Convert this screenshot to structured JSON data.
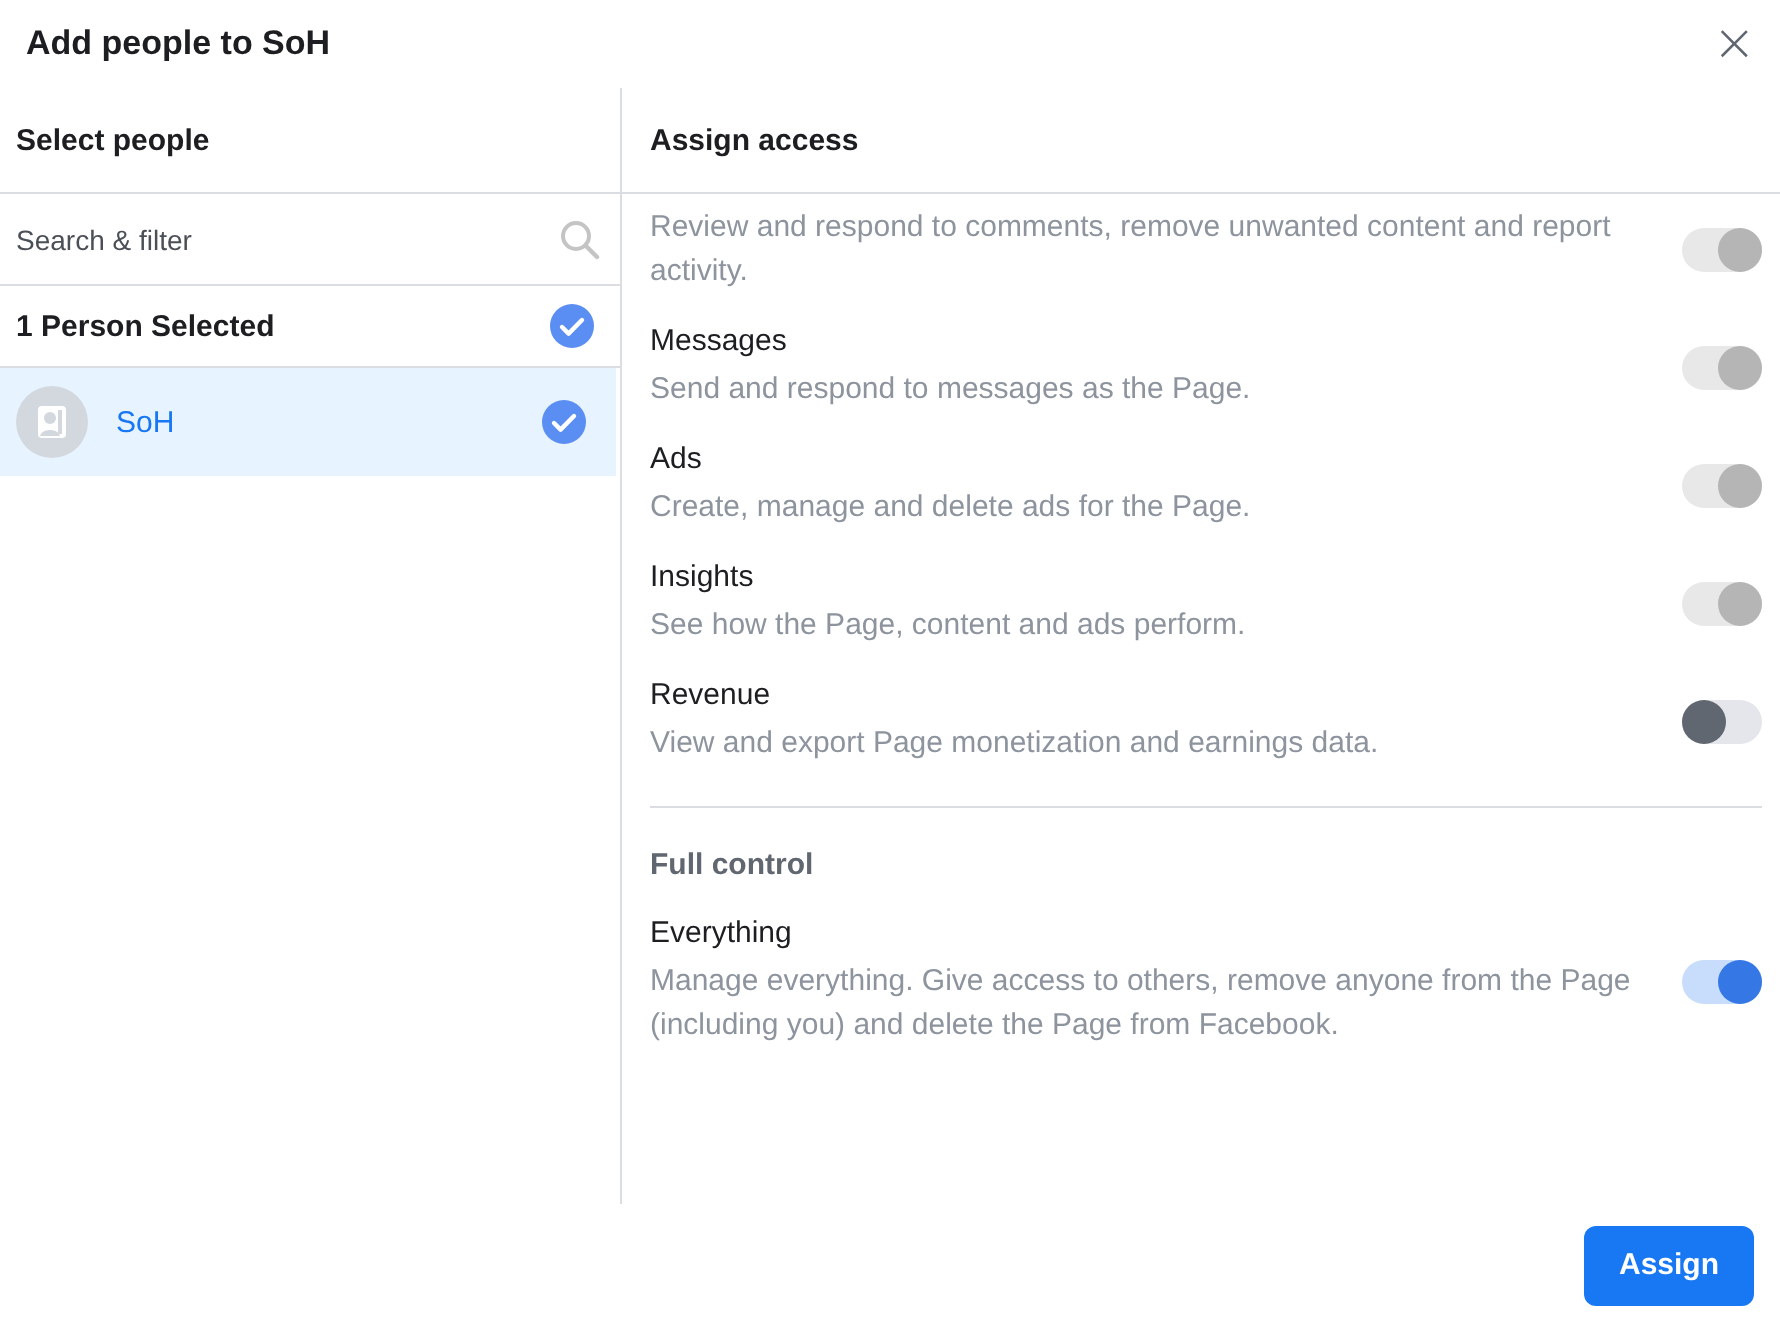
{
  "dialog": {
    "title": "Add people to SoH",
    "close": "×"
  },
  "select_panel": {
    "heading": "Select people",
    "search": {
      "placeholder": "Search & filter"
    },
    "selected_summary": {
      "label": "1 Person Selected",
      "checked": true
    },
    "people": [
      {
        "name": "SoH",
        "selected": true,
        "checked": true
      }
    ]
  },
  "access_panel": {
    "heading": "Assign access",
    "sections": [
      {
        "items": [
          {
            "description": "Review and respond to comments, remove unwanted content and report activity.",
            "on": true,
            "disabled": true
          },
          {
            "title": "Messages",
            "description": "Send and respond to messages as the Page.",
            "on": true,
            "disabled": true
          },
          {
            "title": "Ads",
            "description": "Create, manage and delete ads for the Page.",
            "on": true,
            "disabled": true
          },
          {
            "title": "Insights",
            "description": "See how the Page, content and ads perform.",
            "on": true,
            "disabled": true
          },
          {
            "title": "Revenue",
            "description": "View and export Page monetization and earnings data.",
            "on": false,
            "disabled": false
          }
        ]
      },
      {
        "heading": "Full control",
        "items": [
          {
            "title": "Everything",
            "description": "Manage everything. Give access to others, remove anyone from the Page (including you) and delete the Page from Facebook.",
            "on": true,
            "disabled": false
          }
        ]
      }
    ]
  },
  "buttons": [
    {
      "label": "Assign"
    }
  ]
}
